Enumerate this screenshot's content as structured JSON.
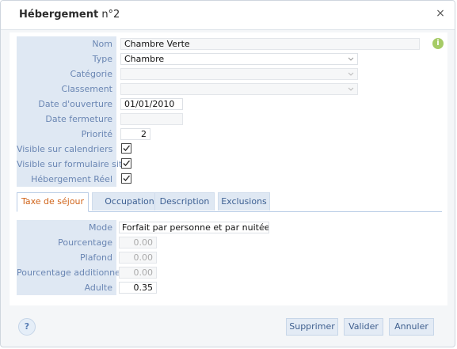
{
  "dialog": {
    "title_main": "Hébergement",
    "title_suffix": " n°2",
    "close_glyph": "×"
  },
  "form": {
    "nom": {
      "label": "Nom",
      "value": "Chambre Verte"
    },
    "type": {
      "label": "Type",
      "value": "Chambre"
    },
    "categorie": {
      "label": "Catégorie",
      "value": ""
    },
    "classement": {
      "label": "Classement",
      "value": ""
    },
    "date_ouverture": {
      "label": "Date d'ouverture",
      "value": "01/01/2010"
    },
    "date_fermeture": {
      "label": "Date fermeture",
      "value": ""
    },
    "priorite": {
      "label": "Priorité",
      "value": "2"
    },
    "visible_calendriers": {
      "label": "Visible sur calendriers",
      "checked": true
    },
    "visible_formulaire": {
      "label": "Visible sur formulaire site",
      "checked": true
    },
    "hebergement_reel": {
      "label": "Hébergement Réel",
      "checked": true
    }
  },
  "info_icon_glyph": "i",
  "tabs": [
    {
      "label": "Taxe de séjour",
      "active": true
    },
    {
      "label": "Occupation",
      "active": false
    },
    {
      "label": "Description",
      "active": false
    },
    {
      "label": "Exclusions",
      "active": false
    }
  ],
  "taxe": {
    "mode": {
      "label": "Mode",
      "value": "Forfait par personne et par nuitée"
    },
    "pourcentage": {
      "label": "Pourcentage",
      "value": "0.00"
    },
    "plafond": {
      "label": "Plafond",
      "value": "0.00"
    },
    "pourcentage_additionnel": {
      "label": "Pourcentage additionnel",
      "value": "0.00"
    },
    "adulte": {
      "label": "Adulte",
      "value": "0.35"
    }
  },
  "footer": {
    "help_glyph": "?",
    "supprimer": "Supprimer",
    "valider": "Valider",
    "annuler": "Annuler"
  },
  "colors": {
    "label_text": "#6a86b3",
    "label_bg": "#dfe8f3",
    "active_tab_text": "#d0641a",
    "info_icon": "#a6cb66"
  }
}
